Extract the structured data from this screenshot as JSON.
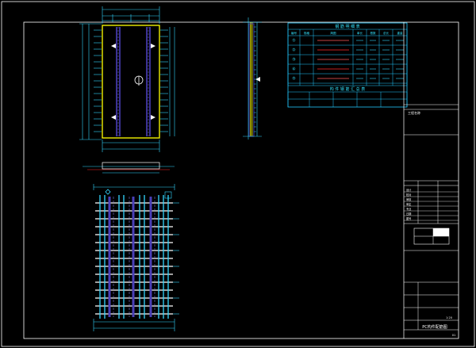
{
  "drawing": {
    "background": "#000000",
    "colors": {
      "frame": "#ffffff",
      "dimension": "#33d6ff",
      "outline": "#f0f000",
      "rebar": "#4a3fb8",
      "highlight": "#ff2a2a",
      "marker": "#ffffff",
      "table_line": "#22c9ff"
    }
  },
  "schedule_table": {
    "title": "钢 筋 明 细 表",
    "subtitle": "构 件 钢 筋 汇 总 表",
    "header": [
      "编号",
      "规格",
      "简图",
      "单长",
      "根数",
      "总长",
      "重量"
    ],
    "rows": [
      {
        "id": "①",
        "highlight": false
      },
      {
        "id": "②",
        "highlight": true
      },
      {
        "id": "③",
        "highlight": false
      },
      {
        "id": "④",
        "highlight": true
      },
      {
        "id": "⑤",
        "highlight": false
      }
    ]
  },
  "title_block": {
    "project_label": "工程名称",
    "drawing_name": "PC构件配筋图",
    "sheet_no": "01",
    "scale_label": "1:20",
    "rows": [
      "设计",
      "校对",
      "审核",
      "审定",
      "专业",
      "日期",
      "图号"
    ]
  },
  "icons": {
    "section_marker": "section-symbol-icon",
    "lifting_point": "lifting-point-icon",
    "grid_marker": "diamond-marker-icon"
  }
}
